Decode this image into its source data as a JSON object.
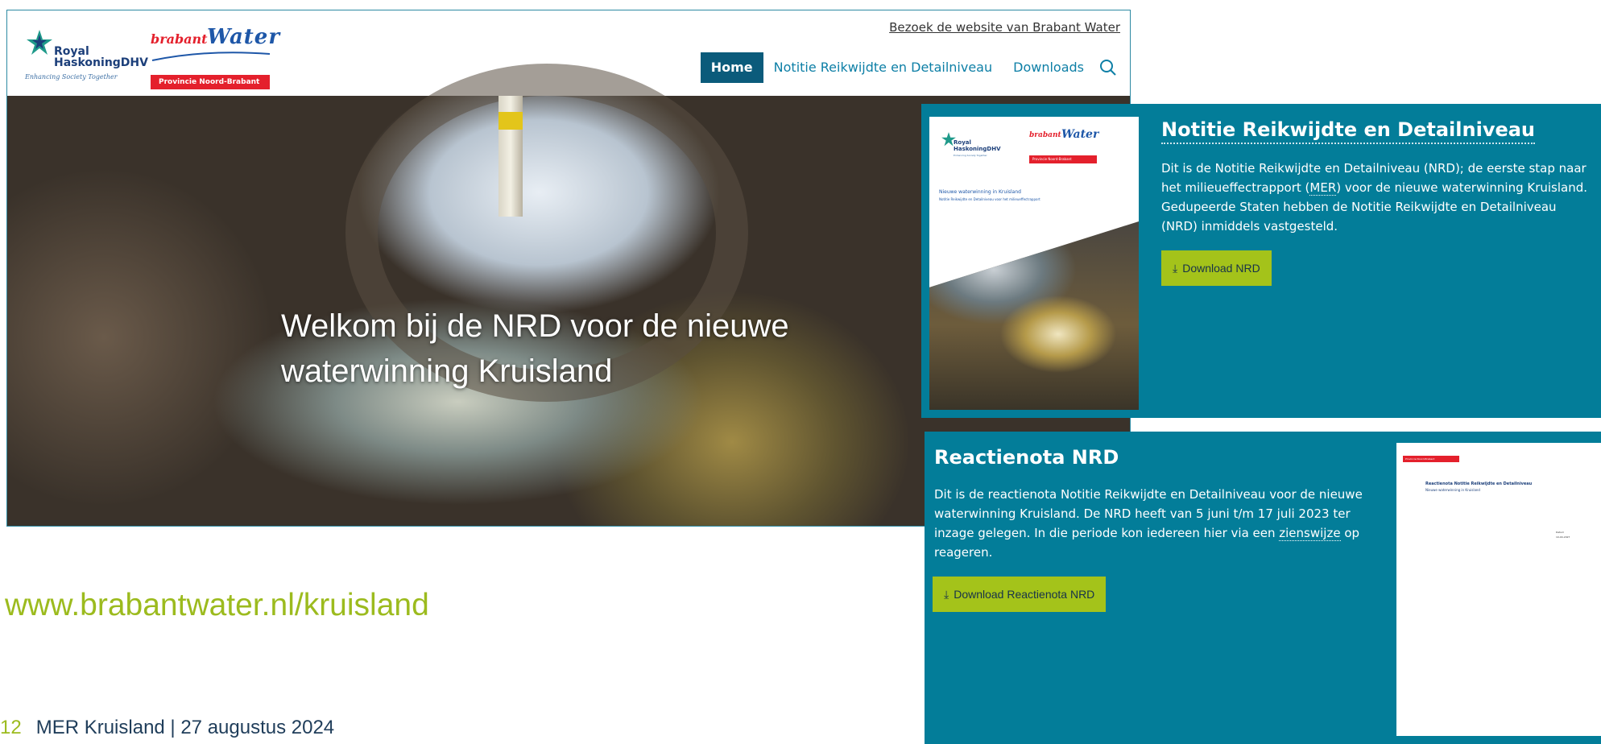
{
  "site": {
    "header": {
      "logo_rhdhv_name": "Royal\nHaskoningDHV",
      "logo_rhdhv_tagline": "Enhancing Society Together",
      "logo_bw_brabant": "brabant",
      "logo_bw_water": "Water",
      "logo_bw_province": "Provincie Noord-Brabant",
      "top_link": "Bezoek de website van Brabant Water"
    },
    "nav": {
      "items": [
        {
          "label": "Home",
          "active": true
        },
        {
          "label": "Notitie Reikwijdte en Detailniveau",
          "active": false
        },
        {
          "label": "Downloads",
          "active": false
        }
      ],
      "search_icon": "search-icon"
    },
    "hero": {
      "title": "Welkom bij de NRD voor de nieuwe waterwinning Kruisland"
    }
  },
  "nrd_card": {
    "heading": "Notitie Reikwijdte en Detailniveau",
    "body_before": "Dit is de Notitie Reikwijdte en Detailniveau (NRD); de eerste stap naar het milieueffectrapport (",
    "body_abbr": "MER",
    "body_after": ") voor de nieuwe waterwinning Kruisland. Gedupeerde Staten hebben de Notitie Reikwijdte en Detailniveau (NRD) inmiddels vastgesteld.",
    "button_label": "Download NRD",
    "cover": {
      "brabant": "brabant",
      "water": "Water",
      "rhdhv": "Royal\nHaskoningDHV",
      "tagline": "Enhancing Society Together",
      "province": "Provincie Noord-Brabant",
      "title": "Nieuwe waterwinning in Kruisland",
      "subtitle": "Notitie Reikwijdte en Detailniveau voor het milieueffectrapport"
    }
  },
  "reactie_card": {
    "heading": "Reactienota NRD",
    "body_before": "Dit is de reactienota Notitie Reikwijdte en Detailniveau voor de nieuwe waterwinning Kruisland. De NRD heeft van 5 juni t/m 17 juli 2023 ter inzage gelegen. In die periode kon iedereen hier via een ",
    "body_abbr": "zienswijze",
    "body_after": " op reageren.",
    "button_label": "Download Reactienota NRD",
    "cover": {
      "province": "Provincie Noord-Brabant",
      "title": "Reactienota Notitie Reikwijdte en Detailniveau",
      "subtitle": "Nieuwe waterwinning in Kruisland",
      "meta": "Datum\n10-04-2027"
    }
  },
  "slide": {
    "url": "www.brabantwater.nl/kruisland",
    "page_number": "12",
    "footer": "MER Kruisland | 27 augustus 2024"
  },
  "colors": {
    "teal": "#037d99",
    "nav_active": "#0b5b7b",
    "lime": "#a4c31a",
    "brand_red": "#e4202c",
    "brand_blue": "#1e57a8"
  }
}
